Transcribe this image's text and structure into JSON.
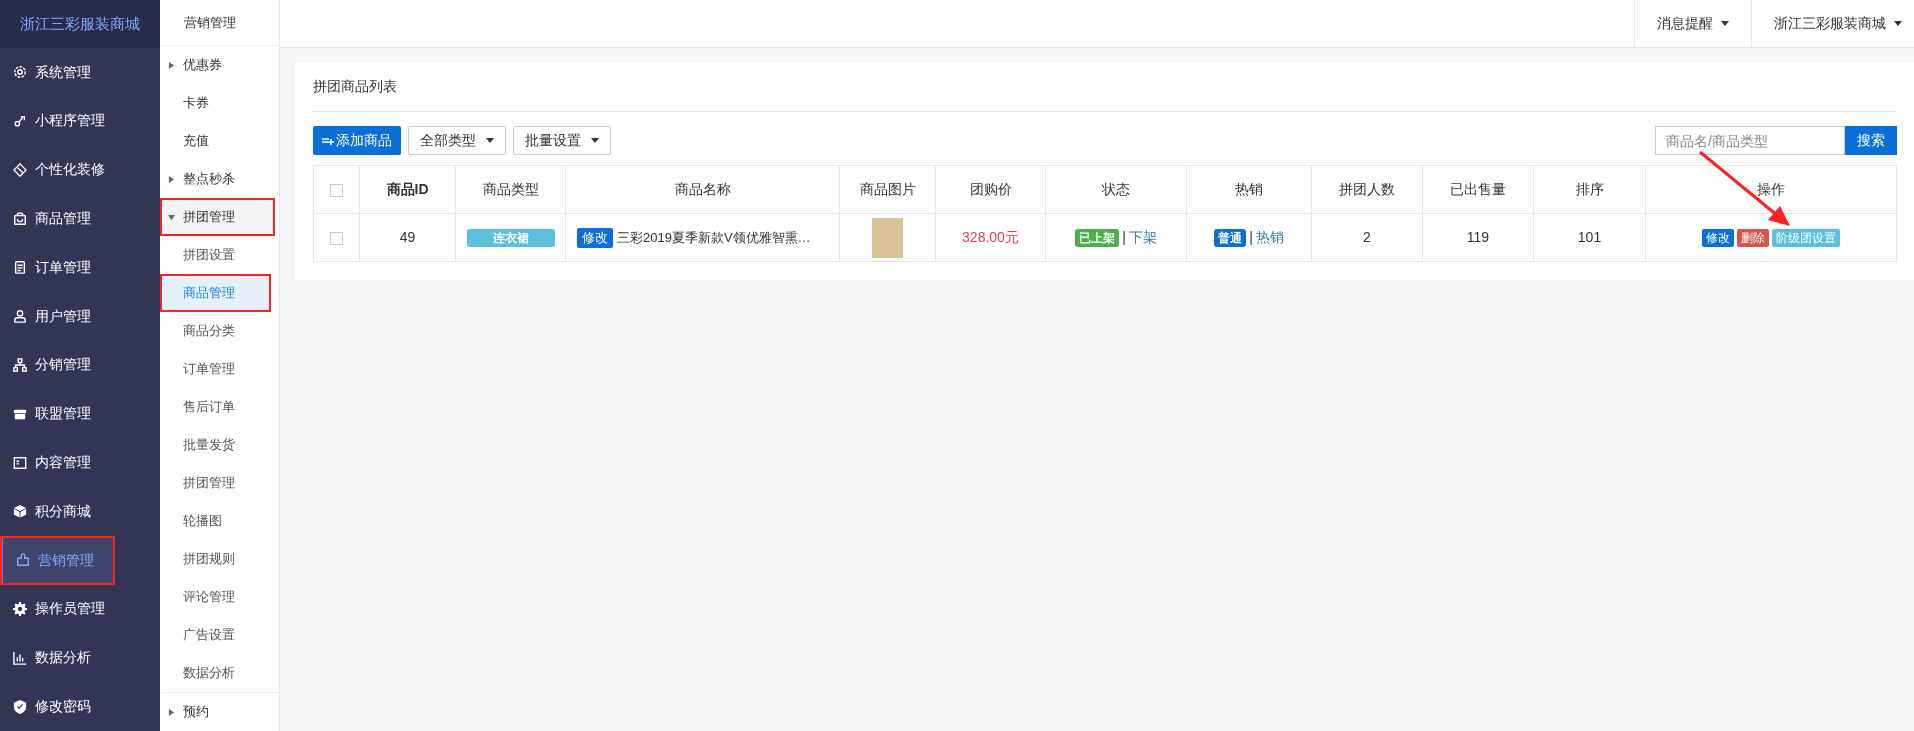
{
  "brand": "浙江三彩服装商城",
  "sidebar": {
    "items": [
      {
        "label": "系统管理",
        "selected": false,
        "highlighted": false
      },
      {
        "label": "小程序管理",
        "selected": false,
        "highlighted": false
      },
      {
        "label": "个性化装修",
        "selected": false,
        "highlighted": false
      },
      {
        "label": "商品管理",
        "selected": false,
        "highlighted": false
      },
      {
        "label": "订单管理",
        "selected": false,
        "highlighted": false
      },
      {
        "label": "用户管理",
        "selected": false,
        "highlighted": false
      },
      {
        "label": "分销管理",
        "selected": false,
        "highlighted": false
      },
      {
        "label": "联盟管理",
        "selected": false,
        "highlighted": false
      },
      {
        "label": "内容管理",
        "selected": false,
        "highlighted": false
      },
      {
        "label": "积分商城",
        "selected": false,
        "highlighted": false
      },
      {
        "label": "营销管理",
        "selected": true,
        "highlighted": true
      },
      {
        "label": "操作员管理",
        "selected": false,
        "highlighted": false
      },
      {
        "label": "数据分析",
        "selected": false,
        "highlighted": false
      },
      {
        "label": "修改密码",
        "selected": false,
        "highlighted": false
      }
    ]
  },
  "submenu": {
    "title": "营销管理",
    "items": [
      {
        "label": "优惠券",
        "expanded": false,
        "selected": false,
        "highlighted": false
      },
      {
        "label": "卡券",
        "selected": false,
        "highlighted": false
      },
      {
        "label": "充值",
        "selected": false,
        "highlighted": false
      },
      {
        "label": "整点秒杀",
        "expanded": false,
        "selected": false,
        "highlighted": false
      },
      {
        "label": "拼团管理",
        "expanded": true,
        "selected": false,
        "highlighted": true,
        "children": [
          {
            "label": "拼团设置",
            "selected": false,
            "highlighted": false
          },
          {
            "label": "商品管理",
            "selected": true,
            "highlighted": true
          },
          {
            "label": "商品分类",
            "selected": false,
            "highlighted": false
          },
          {
            "label": "订单管理",
            "selected": false,
            "highlighted": false
          },
          {
            "label": "售后订单",
            "selected": false,
            "highlighted": false
          },
          {
            "label": "批量发货",
            "selected": false,
            "highlighted": false
          },
          {
            "label": "拼团管理",
            "selected": false,
            "highlighted": false
          },
          {
            "label": "轮播图",
            "selected": false,
            "highlighted": false
          },
          {
            "label": "拼团规则",
            "selected": false,
            "highlighted": false
          },
          {
            "label": "评论管理",
            "selected": false,
            "highlighted": false
          },
          {
            "label": "广告设置",
            "selected": false,
            "highlighted": false
          },
          {
            "label": "数据分析",
            "selected": false,
            "highlighted": false
          }
        ]
      },
      {
        "label": "预约",
        "expanded": false,
        "selected": false,
        "highlighted": false
      }
    ]
  },
  "topbar": {
    "menus": [
      "消息提醒",
      "浙江三彩服装商城"
    ]
  },
  "panel": {
    "title": "拼团商品列表",
    "toolbar": {
      "add_button": "添加商品",
      "dropdowns": [
        "全部类型",
        "批量设置"
      ],
      "search": {
        "placeholder": "商品名/商品类型",
        "button": "搜索"
      }
    },
    "table": {
      "header_checked": false,
      "columns": [
        "商品ID",
        "商品类型",
        "商品名称",
        "商品图片",
        "团购价",
        "状态",
        "热销",
        "拼团人数",
        "已出售量",
        "排序",
        "操作"
      ],
      "rows": [
        {
          "checked": false,
          "id": "49",
          "type": "连衣裙",
          "edit_tag": "修改",
          "name": "三彩2019夏季新款V领优雅智熏…",
          "price": "328.00元",
          "status_tag": "已上架",
          "status_sep": "|",
          "status_link": "下架",
          "hot_tag": "普通",
          "hot_sep": "|",
          "hot_link": "热销",
          "group_size": "2",
          "sold": "119",
          "sort": "101",
          "actions": [
            {
              "label": "修改",
              "kind": "primary"
            },
            {
              "label": "删除",
              "kind": "danger"
            },
            {
              "label": "阶级团设置",
              "kind": "info"
            }
          ]
        }
      ]
    }
  },
  "annotation": {
    "arrow": true
  }
}
